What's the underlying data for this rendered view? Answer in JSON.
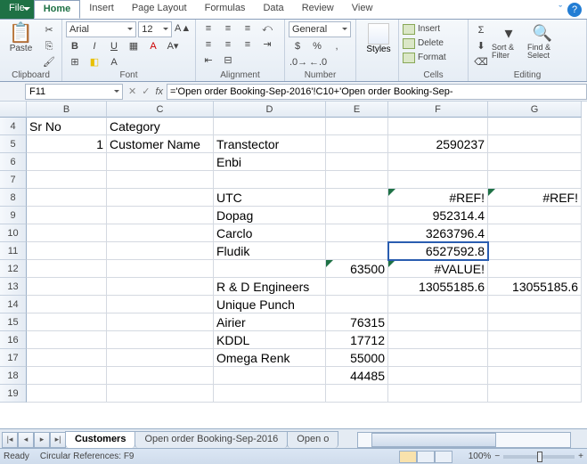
{
  "tabs": {
    "file": "File",
    "home": "Home",
    "insert": "Insert",
    "page": "Page Layout",
    "formulas": "Formulas",
    "data": "Data",
    "review": "Review",
    "view": "View"
  },
  "ribbon": {
    "clipboard": {
      "paste": "Paste",
      "label": "Clipboard"
    },
    "font": {
      "name": "Arial",
      "size": "12",
      "label": "Font"
    },
    "alignment": {
      "label": "Alignment"
    },
    "number": {
      "format": "General",
      "label": "Number"
    },
    "styles": {
      "btn": "Styles"
    },
    "cells": {
      "insert": "Insert",
      "delete": "Delete",
      "format": "Format",
      "label": "Cells"
    },
    "editing": {
      "sort": "Sort & Filter",
      "find": "Find & Select",
      "label": "Editing"
    }
  },
  "name_box": "F11",
  "formula": "='Open order Booking-Sep-2016'!C10+'Open order Booking-Sep-",
  "cols": [
    "",
    "B",
    "C",
    "D",
    "E",
    "F",
    "G"
  ],
  "rows": [
    {
      "n": "4",
      "B": "Sr No",
      "C": "Category"
    },
    {
      "n": "5",
      "B": "1",
      "C": "Customer Name",
      "D": "Transtector",
      "F": "2590237"
    },
    {
      "n": "6",
      "D": "Enbi"
    },
    {
      "n": "7"
    },
    {
      "n": "8",
      "D": "UTC",
      "F": "#REF!",
      "G": "#REF!",
      "Ferr": true,
      "Gerr": true
    },
    {
      "n": "9",
      "D": "Dopag",
      "F": "952314.4"
    },
    {
      "n": "10",
      "D": "Carclo",
      "F": "3263796.4"
    },
    {
      "n": "11",
      "D": "Fludik",
      "F": "6527592.8",
      "selF": true
    },
    {
      "n": "12",
      "E": "63500",
      "F": "#VALUE!",
      "Eerr": true,
      "Ferr": true
    },
    {
      "n": "13",
      "D": "R & D Engineers",
      "F": "13055185.6",
      "G": "13055185.6"
    },
    {
      "n": "14",
      "D": "Unique Punch"
    },
    {
      "n": "15",
      "D": "Airier",
      "E": "76315"
    },
    {
      "n": "16",
      "D": "KDDL",
      "E": "17712"
    },
    {
      "n": "17",
      "D": "Omega Renk",
      "E": "55000"
    },
    {
      "n": "18",
      "E": "44485"
    },
    {
      "n": "19"
    }
  ],
  "sheets": {
    "active": "Customers",
    "s2": "Open order Booking-Sep-2016",
    "s3": "Open o"
  },
  "status": {
    "ready": "Ready",
    "circ": "Circular References: F9",
    "zoom": "100%"
  }
}
